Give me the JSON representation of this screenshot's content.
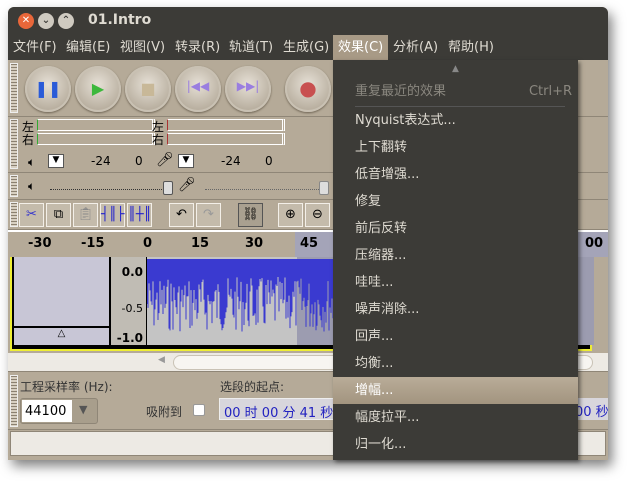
{
  "window": {
    "title": "01.Intro"
  },
  "menubar": [
    "文件(F)",
    "编辑(E)",
    "视图(V)",
    "转录(R)",
    "轨道(T)",
    "生成(G)",
    "效果(C)",
    "分析(A)",
    "帮助(H)"
  ],
  "meters": {
    "left": "左",
    "right": "右",
    "ticks": [
      "-24",
      "0"
    ]
  },
  "ruler": [
    "-30",
    "-15",
    "0",
    "15",
    "30",
    "45",
    "00"
  ],
  "track": {
    "scale": [
      "0.0",
      "-0.5",
      "-1.0"
    ]
  },
  "selection": {
    "rate_label": "工程采样率 (Hz):",
    "rate_value": "44100",
    "snap_label": "吸附到",
    "start_label": "选段的起点:",
    "start_value": "00 时 00 分 41 秒",
    "end_value_tail": "00 秒"
  },
  "effects_menu": {
    "repeat": {
      "label": "重复最近的效果",
      "shortcut": "Ctrl+R"
    },
    "items": [
      "Nyquist表达式...",
      "上下翻转",
      "低音增强...",
      "修复",
      "前后反转",
      "压缩器...",
      "哇哇...",
      "噪声消除...",
      "回声...",
      "均衡...",
      "增幅...",
      "幅度拉平...",
      "归一化..."
    ],
    "highlighted": "增幅..."
  },
  "colors": {
    "waveform": "#3a3ad0",
    "menu_bg": "#3c3b37",
    "highlight": "#a89a86"
  }
}
